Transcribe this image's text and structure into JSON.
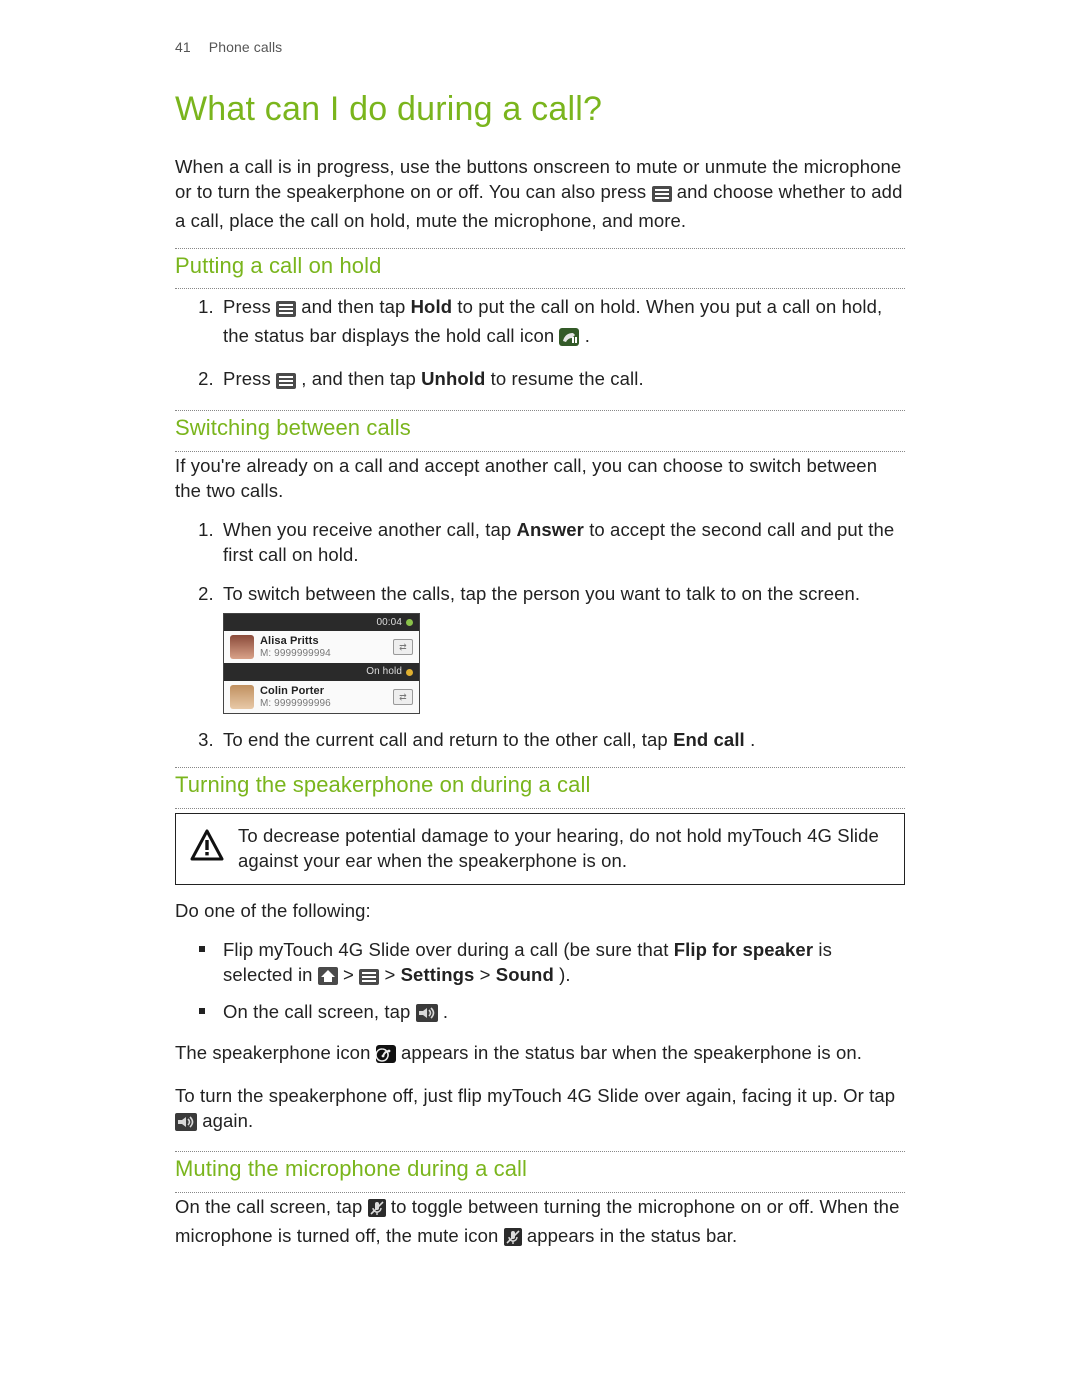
{
  "header": {
    "page_num": "41",
    "chapter": "Phone calls"
  },
  "title": "What can I do during a call?",
  "intro_parts": {
    "before_icon": "When a call is in progress, use the buttons onscreen to mute or unmute the microphone or to turn the speakerphone on or off. You can also press ",
    "after_icon": " and choose whether to add a call, place the call on hold, mute the microphone, and more."
  },
  "sections": {
    "hold": {
      "title": "Putting a call on hold",
      "li1": {
        "a": "Press ",
        "b": " and then tap ",
        "hold_word": "Hold",
        "c": " to put the call on hold. When you put a call on hold, the status bar displays the hold call icon ",
        "d": "."
      },
      "li2": {
        "a": "Press ",
        "b": ", and then tap ",
        "unhold_word": "Unhold",
        "c": " to resume the call."
      }
    },
    "switch": {
      "title": "Switching between calls",
      "intro": "If you're already on a call and accept another call, you can choose to switch between the two calls.",
      "li1": {
        "a": "When you receive another call, tap ",
        "answer_word": "Answer",
        "b": " to accept the second call and put the first call on hold."
      },
      "li2": "To switch between the calls, tap the person you want to talk to on the screen.",
      "li3": {
        "a": "To end the current call and return to the other call, tap ",
        "end_word": "End call",
        "b": "."
      },
      "mock": {
        "timer": "00:04",
        "onhold": "On hold",
        "c1_name": "Alisa Pritts",
        "c1_num": "M: 9999999994",
        "c2_name": "Colin Porter",
        "c2_num": "M: 9999999996"
      }
    },
    "speaker": {
      "title": "Turning the speakerphone on during a call",
      "caution": "To decrease potential damage to your hearing, do not hold myTouch 4G Slide against your ear when the speakerphone is on.",
      "lead": "Do one of the following:",
      "b1": {
        "a": "Flip myTouch 4G Slide over during a call (be sure that ",
        "flip_word": "Flip for speaker",
        "b": " is selected in ",
        "gt1": " > ",
        "gt2": " > ",
        "settings_word": "Settings",
        "gt3": " > ",
        "sound_word": "Sound",
        "end": ")."
      },
      "b2": {
        "a": "On the call screen, tap ",
        "b": "."
      },
      "after1": {
        "a": "The speakerphone icon ",
        "b": " appears in the status bar when the speakerphone is on."
      },
      "after2": {
        "a": "To turn the speakerphone off, just flip myTouch 4G Slide over again, facing it up. Or tap ",
        "b": " again."
      }
    },
    "mute": {
      "title": "Muting the microphone during a call",
      "p": {
        "a": "On the call screen, tap ",
        "b": " to toggle between turning the microphone on or off. When the microphone is turned off, the mute icon ",
        "c": " appears in the status bar."
      }
    }
  }
}
